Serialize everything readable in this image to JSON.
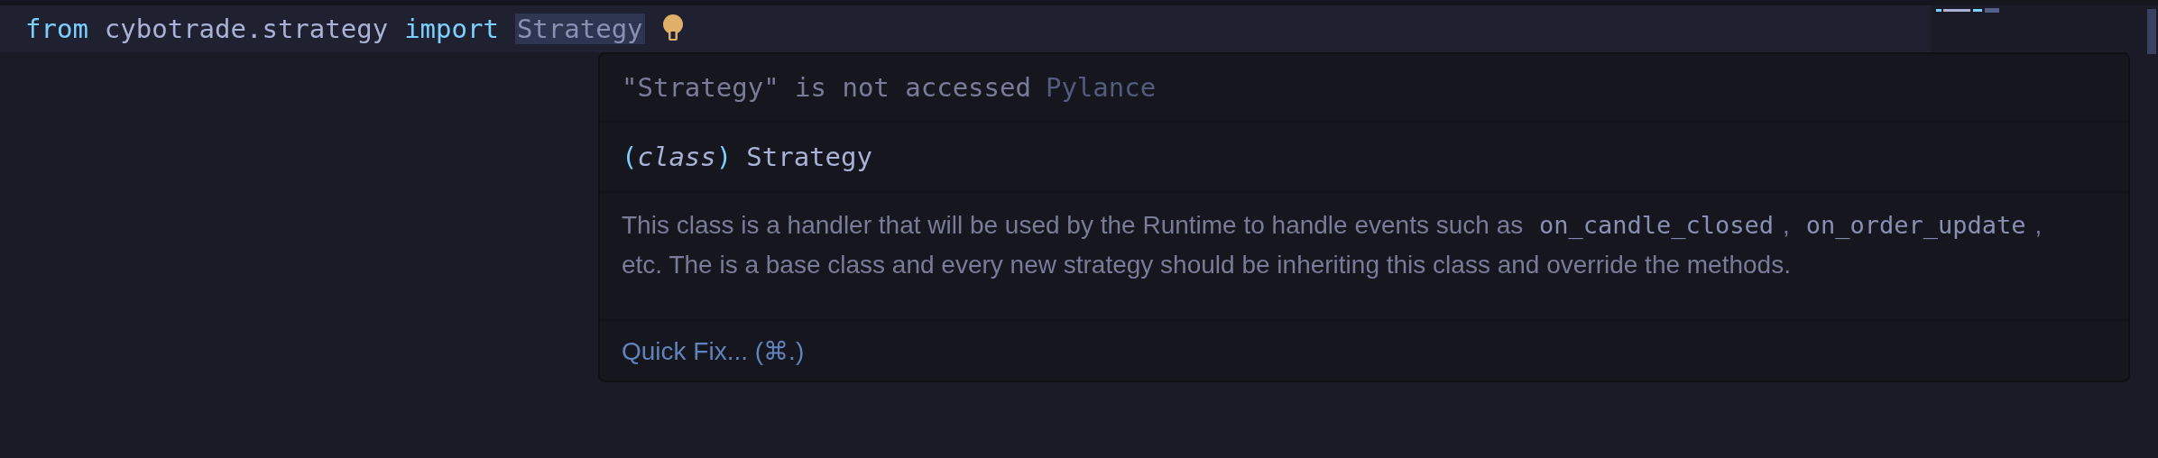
{
  "editor": {
    "tokens": [
      {
        "kind": "keyword",
        "text": "from"
      },
      {
        "kind": "name",
        "text": "cybotrade.strategy"
      },
      {
        "kind": "keyword",
        "text": "import"
      },
      {
        "kind": "highlighted",
        "text": "Strategy"
      }
    ]
  },
  "hover": {
    "diagnostic": {
      "message": "\"Strategy\" is not accessed",
      "source": "Pylance"
    },
    "signature": {
      "kind_label": "(class)",
      "name": "Strategy"
    },
    "doc": [
      {
        "kind": "text",
        "text": "This class is a handler that will be used by the Runtime to handle events such as "
      },
      {
        "kind": "code",
        "text": "on_candle_closed"
      },
      {
        "kind": "text",
        "text": ", "
      },
      {
        "kind": "code",
        "text": "on_order_update"
      },
      {
        "kind": "text",
        "text": ", etc. The is a base class and every new strategy should be inheriting this class and override the methods."
      }
    ],
    "action": "Quick Fix... (⌘.)"
  }
}
